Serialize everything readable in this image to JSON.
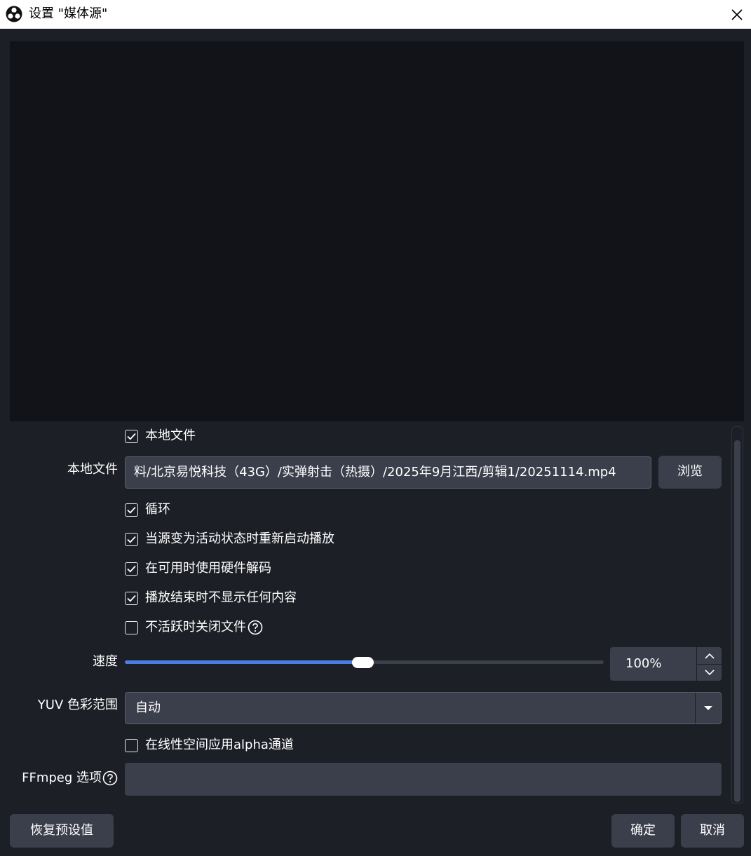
{
  "window": {
    "title": "设置 \"媒体源\"",
    "logo_icon": "obs-logo-icon",
    "close_icon": "close-icon"
  },
  "form": {
    "local_file_checkbox": {
      "label": "本地文件",
      "checked": true
    },
    "local_file": {
      "label": "本地文件",
      "value": "料/北京易悦科技（43G）/实弹射击（热摄）/2025年9月江西/剪辑1/20251114.mp4",
      "browse_label": "浏览"
    },
    "loop": {
      "label": "循环",
      "checked": true
    },
    "restart_on_activate": {
      "label": "当源变为活动状态时重新启动播放",
      "checked": true
    },
    "hw_decode": {
      "label": "在可用时使用硬件解码",
      "checked": true
    },
    "clear_on_end": {
      "label": "播放结束时不显示任何内容",
      "checked": true
    },
    "close_when_inactive": {
      "label": "不活跃时关闭文件",
      "checked": false
    },
    "speed": {
      "label": "速度",
      "value": "100%",
      "slider_fraction": 0.5
    },
    "yuv_range": {
      "label": "YUV 色彩范围",
      "value": "自动"
    },
    "linear_alpha": {
      "label": "在线性空间应用alpha通道",
      "checked": false
    },
    "ffmpeg_options": {
      "label": "FFmpeg 选项",
      "value": ""
    }
  },
  "footer": {
    "defaults_label": "恢复预设值",
    "ok_label": "确定",
    "cancel_label": "取消"
  },
  "colors": {
    "accent": "#4a7ee0",
    "panel_bg": "#1d1f26",
    "preview_bg": "#121318",
    "control_bg": "#3b3e4b"
  }
}
